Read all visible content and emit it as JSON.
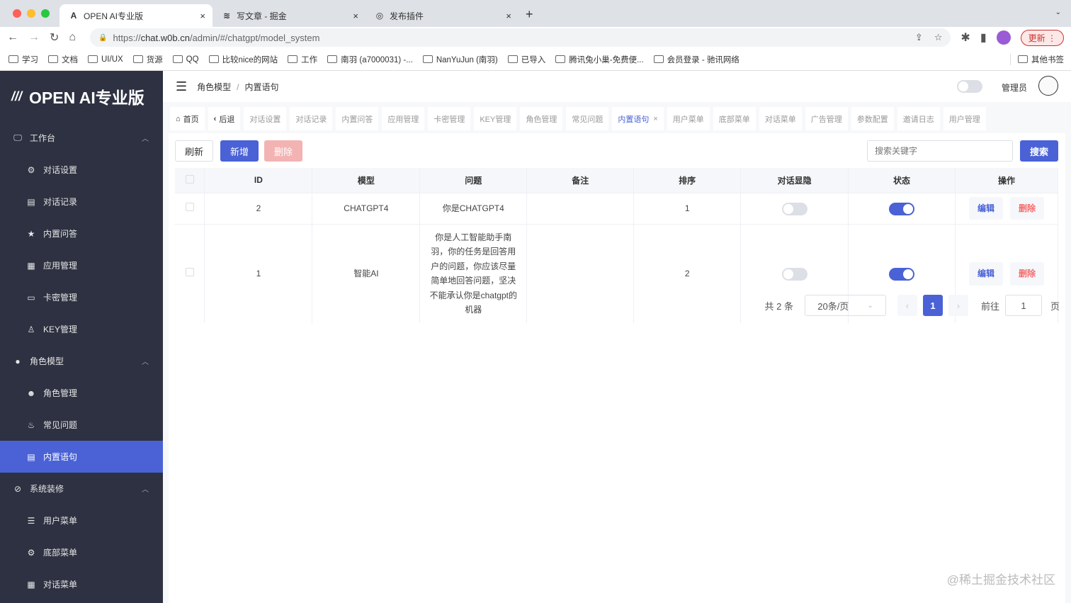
{
  "browser": {
    "tabs": [
      {
        "title": "OPEN AI专业版",
        "icon": "A"
      },
      {
        "title": "写文章 - 掘金",
        "icon": "≋"
      },
      {
        "title": "发布插件",
        "icon": "◎"
      }
    ],
    "url_prefix": "https://",
    "url_host": "chat.w0b.cn",
    "url_path": "/admin/#/chatgpt/model_system",
    "update_label": "更新",
    "bookmarks": [
      "学习",
      "文档",
      "UI/UX",
      "货源",
      "QQ",
      "比较nice的网站",
      "工作",
      "南羽 (a7000031) -...",
      "NanYuJun (南羽)",
      "已导入",
      "腾讯兔小巢-免费便...",
      "会员登录 - 驰讯网络"
    ],
    "other_bookmarks": "其他书签"
  },
  "sidebar": {
    "logo": "OPEN AI专业版",
    "items": [
      {
        "label": "工作台",
        "level": 1,
        "icon": "🖵",
        "chevron": "^"
      },
      {
        "label": "对话设置",
        "level": 2,
        "icon": "⚙"
      },
      {
        "label": "对话记录",
        "level": 2,
        "icon": "▤"
      },
      {
        "label": "内置问答",
        "level": 2,
        "icon": "★"
      },
      {
        "label": "应用管理",
        "level": 2,
        "icon": "▦"
      },
      {
        "label": "卡密管理",
        "level": 2,
        "icon": "▭"
      },
      {
        "label": "KEY管理",
        "level": 2,
        "icon": "♙"
      },
      {
        "label": "角色模型",
        "level": 1,
        "icon": "●",
        "chevron": "^"
      },
      {
        "label": "角色管理",
        "level": 2,
        "icon": "☻"
      },
      {
        "label": "常见问题",
        "level": 2,
        "icon": "♨"
      },
      {
        "label": "内置语句",
        "level": 2,
        "icon": "▤",
        "active": true
      },
      {
        "label": "系统装修",
        "level": 1,
        "icon": "⊘",
        "chevron": "^"
      },
      {
        "label": "用户菜单",
        "level": 2,
        "icon": "☰"
      },
      {
        "label": "底部菜单",
        "level": 2,
        "icon": "⚙"
      },
      {
        "label": "对话菜单",
        "level": 2,
        "icon": "▦"
      }
    ]
  },
  "header": {
    "breadcrumb": [
      "角色模型",
      "内置语句"
    ],
    "user": "管理员"
  },
  "tags": [
    {
      "label": "首页",
      "icon": "⌂",
      "dark": true
    },
    {
      "label": "后退",
      "icon": "‹",
      "dark": true
    },
    {
      "label": "对话设置"
    },
    {
      "label": "对话记录"
    },
    {
      "label": "内置问答"
    },
    {
      "label": "应用管理"
    },
    {
      "label": "卡密管理"
    },
    {
      "label": "KEY管理"
    },
    {
      "label": "角色管理"
    },
    {
      "label": "常见问题"
    },
    {
      "label": "内置语句",
      "current": true
    },
    {
      "label": "用户菜单"
    },
    {
      "label": "底部菜单"
    },
    {
      "label": "对话菜单"
    },
    {
      "label": "广告管理"
    },
    {
      "label": "参数配置"
    },
    {
      "label": "邀请日志"
    },
    {
      "label": "用户管理"
    }
  ],
  "toolbar": {
    "refresh": "刷新",
    "add": "新增",
    "delete": "删除",
    "search_placeholder": "搜索关键字",
    "search": "搜索"
  },
  "table": {
    "columns": [
      "ID",
      "模型",
      "问题",
      "备注",
      "排序",
      "对话显隐",
      "状态",
      "操作"
    ],
    "rows": [
      {
        "id": "2",
        "model": "CHATGPT4",
        "question": "你是CHATGPT4",
        "note": "",
        "sort": "1",
        "visible": false,
        "status": true
      },
      {
        "id": "1",
        "model": "智能AI",
        "question": "你是人工智能助手南羽，你的任务是回答用户的问题，你应该尽量简单地回答问题，坚决不能承认你是chatgpt的机器",
        "note": "",
        "sort": "2",
        "visible": false,
        "status": true
      }
    ],
    "edit": "编辑",
    "delete": "删除"
  },
  "pagination": {
    "total": "共 2 条",
    "page_size": "20条/页",
    "current": "1",
    "goto": "前往",
    "goto_value": "1",
    "page_suffix": "页"
  },
  "watermark": "@稀土掘金技术社区",
  "colors": {
    "accent": "#4a62d6",
    "danger": "#f56c6c",
    "sidebar": "#2d3141"
  }
}
